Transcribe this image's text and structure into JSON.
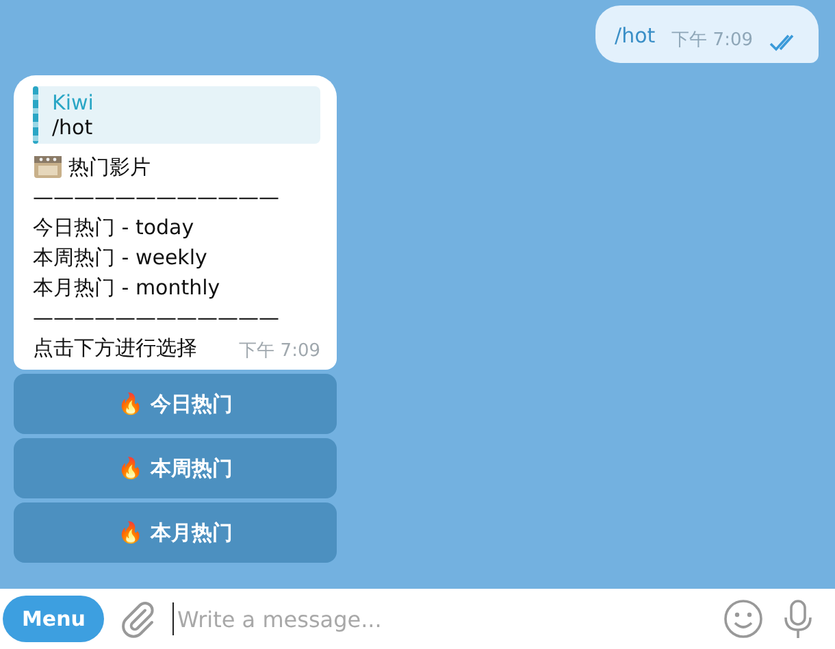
{
  "outgoing": {
    "text": "/hot",
    "time": "下午 7:09",
    "read": true
  },
  "incoming": {
    "reply": {
      "author": "Kiwi",
      "text": "/hot"
    },
    "title": "热门影片",
    "lines": [
      "————————————",
      "今日热门 - today",
      "本周热门 - weekly",
      "本月热门 - monthly",
      "————————————"
    ],
    "last_line": "点击下方进行选择",
    "time": "下午 7:09"
  },
  "keyboard": [
    {
      "icon": "🔥",
      "label": "今日热门"
    },
    {
      "icon": "🔥",
      "label": "本周热门"
    },
    {
      "icon": "🔥",
      "label": "本月热门"
    }
  ],
  "composer": {
    "menu": "Menu",
    "placeholder": "Write a message..."
  }
}
